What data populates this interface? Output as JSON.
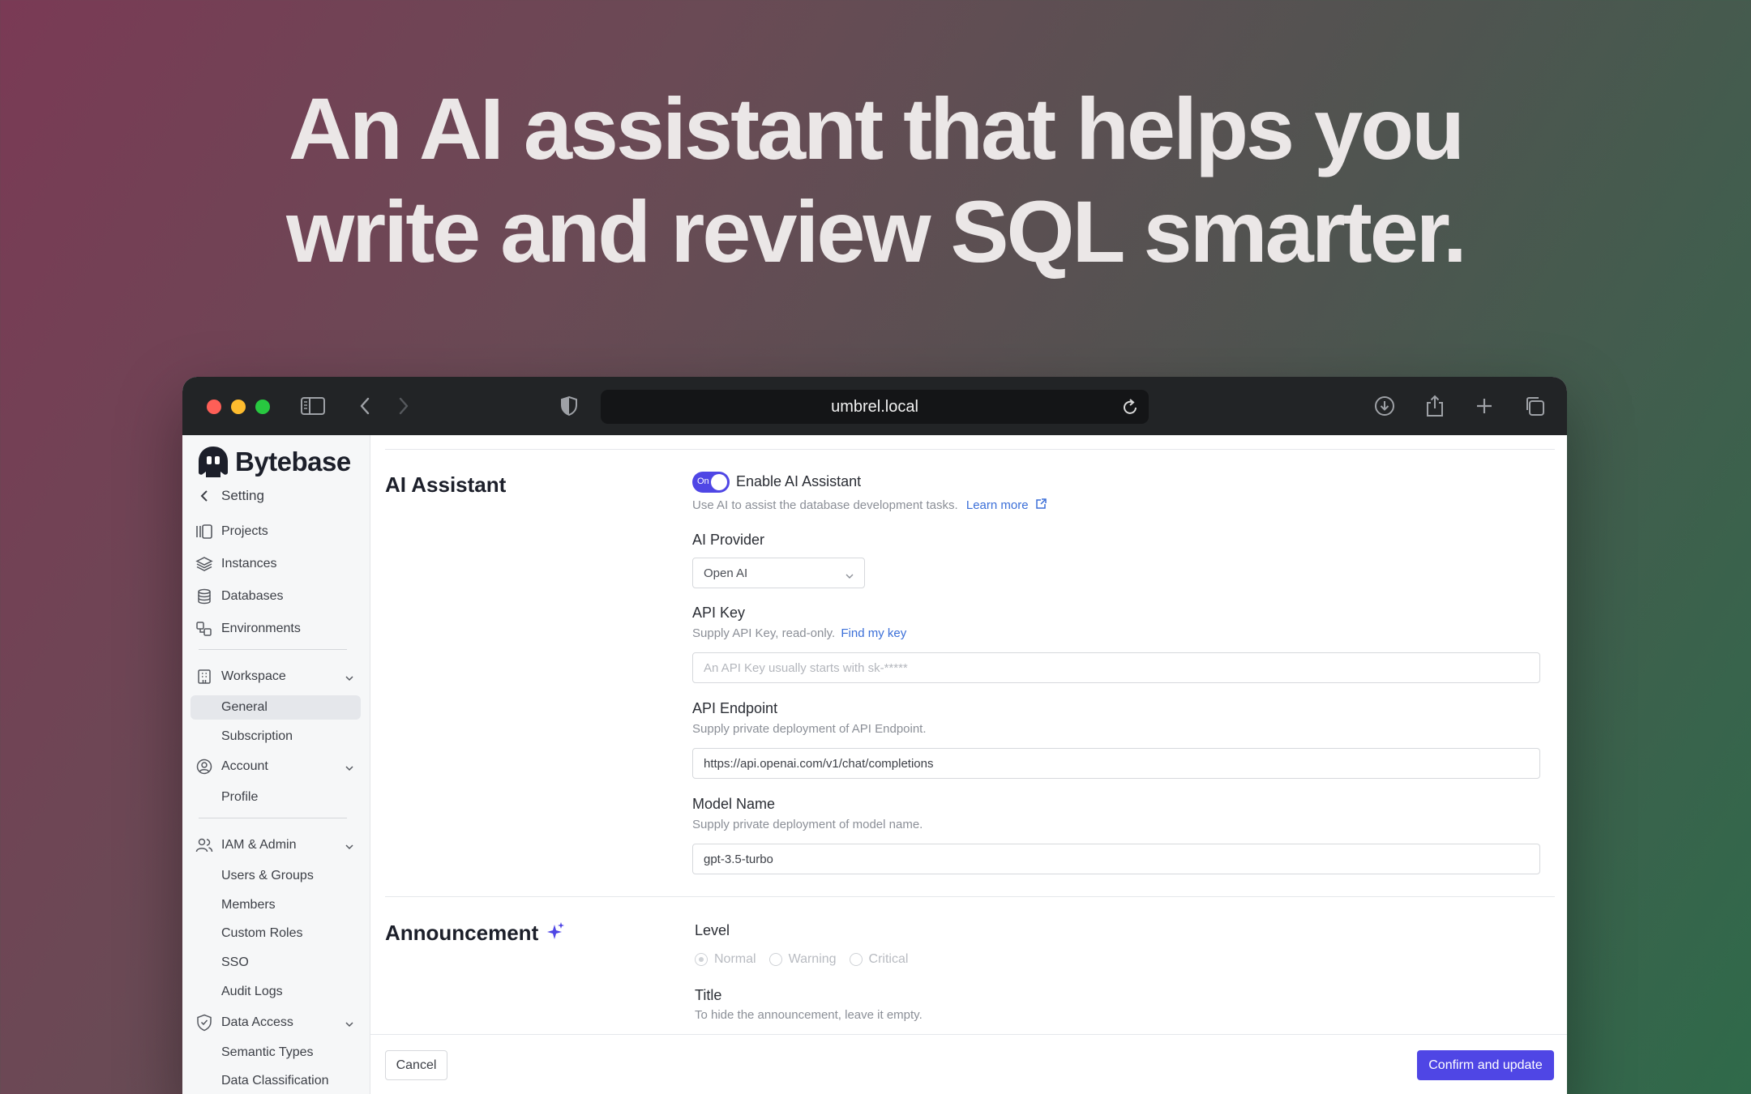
{
  "hero": {
    "line1": "An AI assistant that helps you",
    "line2": "write and review SQL smarter."
  },
  "browser": {
    "url": "umbrel.local",
    "controls": [
      "close",
      "minimize",
      "zoom",
      "sidebar-icon",
      "back-icon",
      "forward-icon",
      "shield-icon",
      "reload-icon",
      "download-icon",
      "share-icon",
      "plus-icon",
      "tabs-icon"
    ]
  },
  "sidebar": {
    "brand": "Bytebase",
    "back_label": "Setting",
    "items": [
      {
        "label": "Projects",
        "icon": "projects-icon"
      },
      {
        "label": "Instances",
        "icon": "layers-icon"
      },
      {
        "label": "Databases",
        "icon": "database-icon"
      },
      {
        "label": "Environments",
        "icon": "environments-icon"
      }
    ],
    "workspace": {
      "label": "Workspace",
      "children": [
        "General",
        "Subscription"
      ],
      "active": "General"
    },
    "account": {
      "label": "Account",
      "children": [
        "Profile"
      ]
    },
    "iam": {
      "label": "IAM & Admin",
      "children": [
        "Users & Groups",
        "Members",
        "Custom Roles",
        "SSO",
        "Audit Logs"
      ]
    },
    "data_access": {
      "label": "Data Access",
      "children": [
        "Semantic Types",
        "Data Classification"
      ]
    }
  },
  "ai_section": {
    "title": "AI Assistant",
    "toggle_on_label": "On",
    "enable_label": "Enable AI Assistant",
    "enable_help": "Use AI to assist the database development tasks.",
    "learn_more": "Learn more",
    "provider_label": "AI Provider",
    "provider_value": "Open AI",
    "api_key_label": "API Key",
    "api_key_help": "Supply API Key, read-only.",
    "find_key": "Find my key",
    "api_key_placeholder": "An API Key usually starts with sk-*****",
    "endpoint_label": "API Endpoint",
    "endpoint_help": "Supply private deployment of API Endpoint.",
    "endpoint_value": "https://api.openai.com/v1/chat/completions",
    "model_label": "Model Name",
    "model_help": "Supply private deployment of model name.",
    "model_value": "gpt-3.5-turbo"
  },
  "announcement": {
    "title": "Announcement",
    "level_label": "Level",
    "levels": [
      "Normal",
      "Warning",
      "Critical"
    ],
    "selected_level": "Normal",
    "title_label": "Title",
    "title_help": "To hide the announcement, leave it empty."
  },
  "footer": {
    "cancel": "Cancel",
    "confirm": "Confirm and update"
  },
  "colors": {
    "accent": "#4f46e5",
    "link": "#3b6fd8",
    "sparkle": "#4f46e5"
  }
}
